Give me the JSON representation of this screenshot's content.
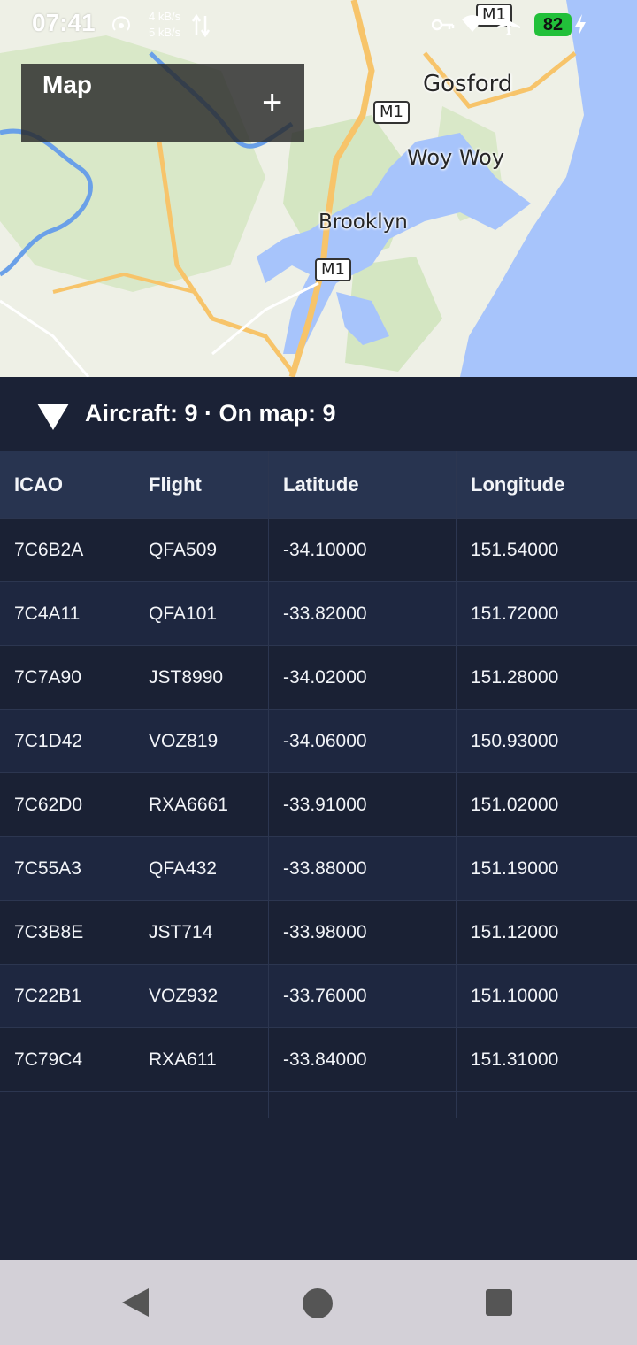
{
  "status_bar": {
    "time": "07:41",
    "up_speed": "4 kB/s",
    "down_speed": "5 kB/s",
    "battery": "82",
    "icons": [
      "hotspot-icon",
      "data-arrows-icon",
      "key-icon",
      "wifi-icon",
      "airplane-icon",
      "charging-icon"
    ]
  },
  "map": {
    "card_title": "Map",
    "add_label": "+",
    "places": {
      "gosford": "Gosford",
      "woy_woy": "Woy Woy",
      "brooklyn": "Brooklyn"
    },
    "road_shields": [
      "M1",
      "M1",
      "M1"
    ],
    "colors": {
      "water": "#a7c4fb",
      "land": "#eef0e6",
      "park": "#d9e8c8",
      "road": "#f7c46a",
      "river": "#6aa0e8"
    }
  },
  "panel": {
    "summary": "Aircraft: 9 · On map: 9",
    "columns": [
      "ICAO",
      "Flight",
      "Latitude",
      "Longitude"
    ],
    "rows": [
      [
        "7C6B2A",
        "QFA509",
        "-34.10000",
        "151.54000"
      ],
      [
        "7C4A11",
        "QFA101",
        "-33.82000",
        "151.72000"
      ],
      [
        "7C7A90",
        "JST8990",
        "-34.02000",
        "151.28000"
      ],
      [
        "7C1D42",
        "VOZ819",
        "-34.06000",
        "150.93000"
      ],
      [
        "7C62D0",
        "RXA6661",
        "-33.91000",
        "151.02000"
      ],
      [
        "7C55A3",
        "QFA432",
        "-33.88000",
        "151.19000"
      ],
      [
        "7C3B8E",
        "JST714",
        "-33.98000",
        "151.12000"
      ],
      [
        "7C22B1",
        "VOZ932",
        "-33.76000",
        "151.10000"
      ],
      [
        "7C79C4",
        "RXA611",
        "-33.84000",
        "151.31000"
      ]
    ],
    "colors": {
      "header_bg": "#283450",
      "row_even": "#1e2740",
      "row_odd": "#1a2134",
      "text": "#f2f4f8"
    }
  },
  "nav_bar": {
    "buttons": [
      "back",
      "home",
      "recents"
    ]
  }
}
